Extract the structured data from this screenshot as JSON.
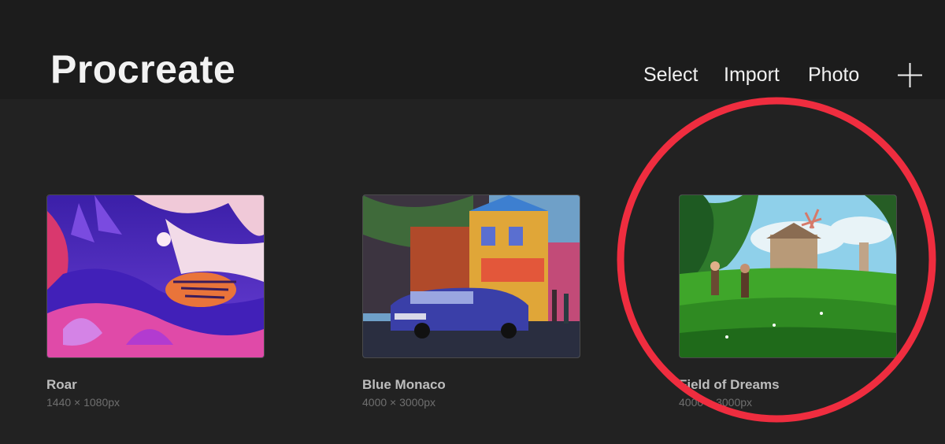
{
  "header": {
    "title": "Procreate",
    "actions": {
      "select": "Select",
      "import": "Import",
      "photo": "Photo"
    },
    "add_icon": "plus-icon"
  },
  "gallery": {
    "artworks": [
      {
        "title": "Roar",
        "size": "1440 × 1080px"
      },
      {
        "title": "Blue Monaco",
        "size": "4000 × 3000px"
      },
      {
        "title": "Field of Dreams",
        "size": "4000 × 3000px"
      }
    ]
  },
  "annotation": {
    "color": "#ef2d3f",
    "target": "Field of Dreams"
  }
}
